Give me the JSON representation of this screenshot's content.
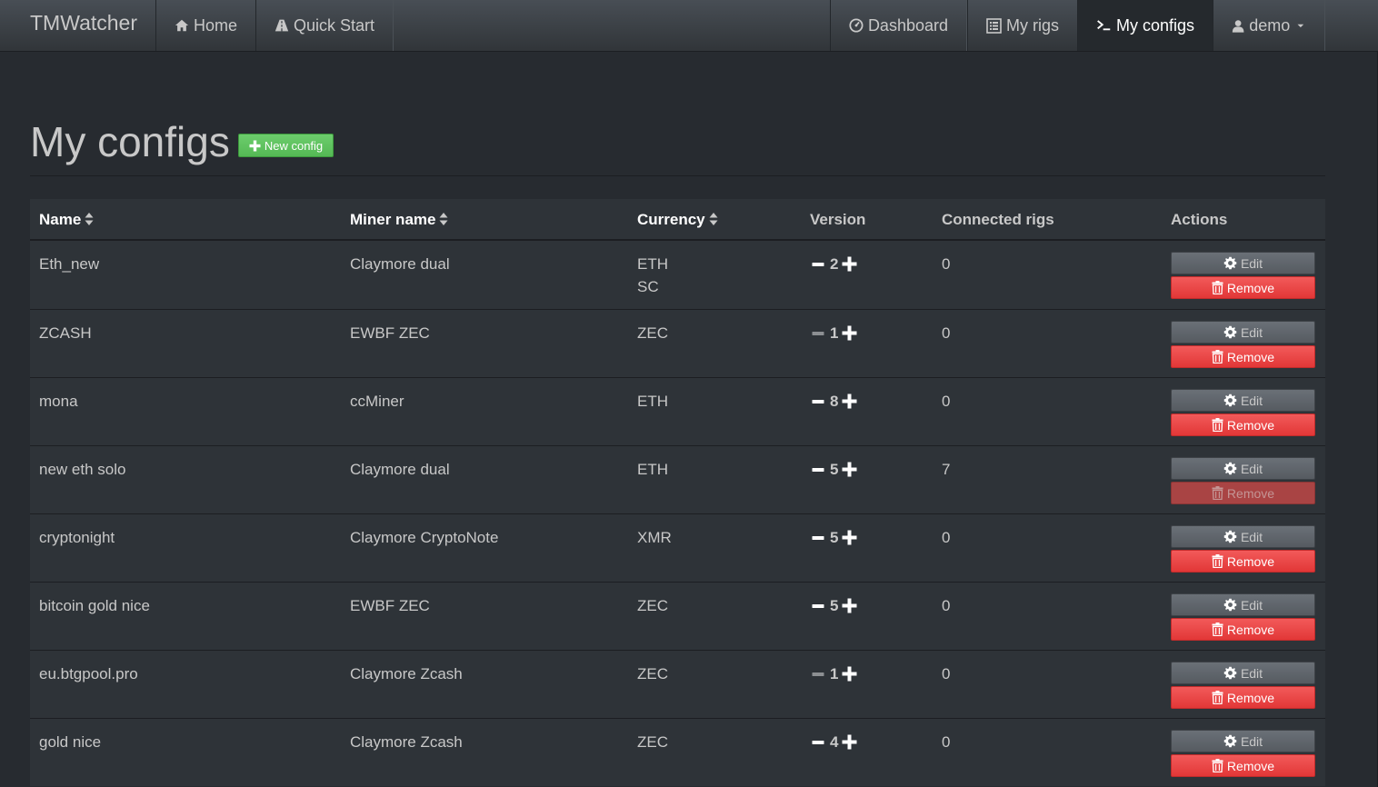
{
  "navbar": {
    "brand": "TMWatcher",
    "left_items": [
      {
        "label": "Home",
        "icon": "home-icon"
      },
      {
        "label": "Quick Start",
        "icon": "road-icon"
      }
    ],
    "right_items": [
      {
        "label": "Dashboard",
        "icon": "dashboard-icon",
        "active": false
      },
      {
        "label": "My rigs",
        "icon": "list-icon",
        "active": false
      },
      {
        "label": "My configs",
        "icon": "terminal-icon",
        "active": true
      },
      {
        "label": "demo",
        "icon": "user-icon",
        "active": false,
        "dropdown": true
      }
    ]
  },
  "header": {
    "title": "My configs",
    "new_button": "New config"
  },
  "table": {
    "columns": [
      "Name",
      "Miner name",
      "Currency",
      "Version",
      "Connected rigs",
      "Actions"
    ],
    "sortable": [
      true,
      true,
      true,
      false,
      false,
      false
    ],
    "rows": [
      {
        "name": "Eth_new",
        "miner": "Claymore dual",
        "currency": [
          "ETH",
          "SC"
        ],
        "version": "2",
        "minus_enabled": true,
        "rigs": "0",
        "remove_enabled": true
      },
      {
        "name": "ZCASH",
        "miner": "EWBF ZEC",
        "currency": [
          "ZEC"
        ],
        "version": "1",
        "minus_enabled": false,
        "rigs": "0",
        "remove_enabled": true
      },
      {
        "name": "mona",
        "miner": "ccMiner",
        "currency": [
          "ETH"
        ],
        "version": "8",
        "minus_enabled": true,
        "rigs": "0",
        "remove_enabled": true
      },
      {
        "name": "new eth solo",
        "miner": "Claymore dual",
        "currency": [
          "ETH"
        ],
        "version": "5",
        "minus_enabled": true,
        "rigs": "7",
        "remove_enabled": false
      },
      {
        "name": "cryptonight",
        "miner": "Claymore CryptoNote",
        "currency": [
          "XMR"
        ],
        "version": "5",
        "minus_enabled": true,
        "rigs": "0",
        "remove_enabled": true
      },
      {
        "name": "bitcoin gold nice",
        "miner": "EWBF ZEC",
        "currency": [
          "ZEC"
        ],
        "version": "5",
        "minus_enabled": true,
        "rigs": "0",
        "remove_enabled": true
      },
      {
        "name": "eu.btgpool.pro",
        "miner": "Claymore Zcash",
        "currency": [
          "ZEC"
        ],
        "version": "1",
        "minus_enabled": false,
        "rigs": "0",
        "remove_enabled": true
      },
      {
        "name": "gold nice",
        "miner": "Claymore Zcash",
        "currency": [
          "ZEC"
        ],
        "version": "4",
        "minus_enabled": true,
        "rigs": "0",
        "remove_enabled": true
      }
    ],
    "edit_label": "Edit",
    "remove_label": "Remove"
  },
  "colors": {
    "background": "#272b30",
    "success": "#62c462",
    "danger": "#ee5f5b",
    "edit": "#6a7077"
  }
}
